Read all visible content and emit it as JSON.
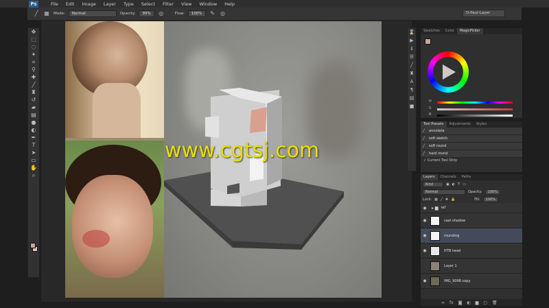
{
  "app": {
    "logo": "Ps"
  },
  "menu": [
    "File",
    "Edit",
    "Image",
    "Layer",
    "Type",
    "Select",
    "Filter",
    "View",
    "Window",
    "Help"
  ],
  "options_bar": {
    "mode_label": "Mode:",
    "mode_value": "Normal",
    "opacity_label": "Opacity:",
    "opacity_value": "99%",
    "flow_label": "Flow:",
    "flow_value": "100%",
    "workspace": "D-Paul-Layer"
  },
  "tools": [
    "move",
    "marquee",
    "lasso",
    "quick-select",
    "crop",
    "eyedropper",
    "healing",
    "brush",
    "stamp",
    "history",
    "eraser",
    "gradient",
    "blur",
    "dodge",
    "pen",
    "type",
    "path-select",
    "shape",
    "hand",
    "zoom"
  ],
  "watermark": "www.cgtsj.com",
  "color_panel": {
    "tabs": [
      "Swatches",
      "Color",
      "MagicPicker"
    ],
    "active_tab": "MagicPicker",
    "slider_labels": [
      "H",
      "S",
      "B"
    ],
    "foreground": "#c9a59a"
  },
  "tool_presets": {
    "tabs": [
      "Tool Presets",
      "Adjustments",
      "Styles"
    ],
    "items": [
      "annotate",
      "soft sketch",
      "soft round",
      "hard round"
    ],
    "current_only": "Current Tool Only"
  },
  "layers_panel": {
    "tabs": [
      "Layers",
      "Channels",
      "Paths"
    ],
    "kind_label": "Kind",
    "blend_mode": "Normal",
    "opacity_label": "Opacity:",
    "opacity_value": "100%",
    "lock_label": "Lock:",
    "fill_label": "Fill:",
    "fill_value": "100%",
    "layers": [
      {
        "name": "ref",
        "type": "group",
        "visible": true
      },
      {
        "name": "cast shadow",
        "visible": true
      },
      {
        "name": "rounding",
        "visible": true,
        "selected": true
      },
      {
        "name": "HTB head",
        "visible": true
      },
      {
        "name": "Layer 1",
        "visible": false
      },
      {
        "name": "IMG_9098 copy",
        "visible": true
      }
    ]
  }
}
